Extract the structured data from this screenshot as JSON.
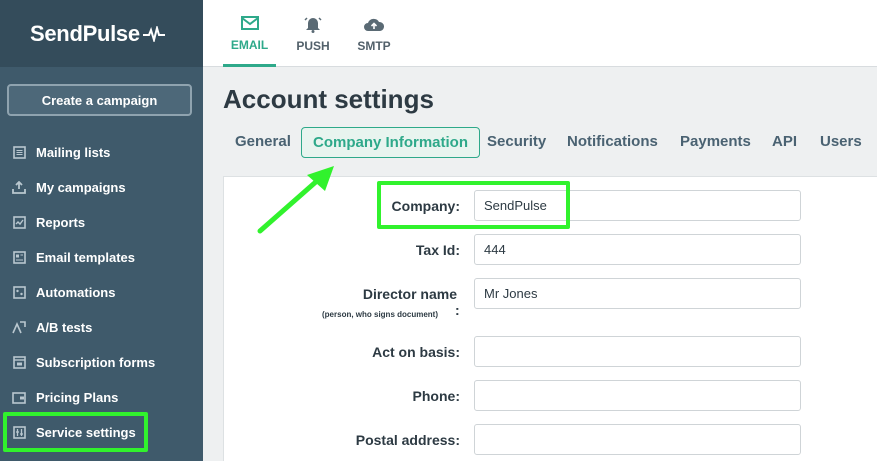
{
  "app": {
    "logo_text": "SendPulse"
  },
  "sidebar": {
    "create_button": "Create a campaign",
    "items": [
      {
        "label": "Mailing lists",
        "icon": "mailing-lists-icon"
      },
      {
        "label": "My campaigns",
        "icon": "campaigns-icon"
      },
      {
        "label": "Reports",
        "icon": "reports-icon"
      },
      {
        "label": "Email templates",
        "icon": "templates-icon"
      },
      {
        "label": "Automations",
        "icon": "automations-icon"
      },
      {
        "label": "A/B tests",
        "icon": "ab-tests-icon"
      },
      {
        "label": "Subscription forms",
        "icon": "forms-icon"
      },
      {
        "label": "Pricing Plans",
        "icon": "wallet-icon"
      },
      {
        "label": "Service settings",
        "icon": "settings-icon"
      }
    ]
  },
  "topnav": {
    "tabs": [
      {
        "label": "EMAIL",
        "icon": "envelope-icon",
        "active": true
      },
      {
        "label": "PUSH",
        "icon": "bell-icon",
        "active": false
      },
      {
        "label": "SMTP",
        "icon": "cloud-upload-icon",
        "active": false
      }
    ]
  },
  "page": {
    "title": "Account settings",
    "tabs": [
      "General",
      "Company Information",
      "Security",
      "Notifications",
      "Payments",
      "API",
      "Users"
    ],
    "active_tab": "Company Information"
  },
  "form": {
    "company": {
      "label": "Company:",
      "value": "SendPulse"
    },
    "tax_id": {
      "label": "Tax Id:",
      "value": "444"
    },
    "director": {
      "label": "Director name",
      "sublabel": "(person, who signs document)",
      "colon": ":",
      "value": "Mr Jones"
    },
    "act_on_basis": {
      "label": "Act on basis:",
      "value": ""
    },
    "phone": {
      "label": "Phone:",
      "value": ""
    },
    "postal_address": {
      "label": "Postal address:",
      "value": ""
    }
  },
  "colors": {
    "sidebar": "#3f5a6b",
    "accent": "#2ea98a",
    "highlight": "#31f22d"
  }
}
